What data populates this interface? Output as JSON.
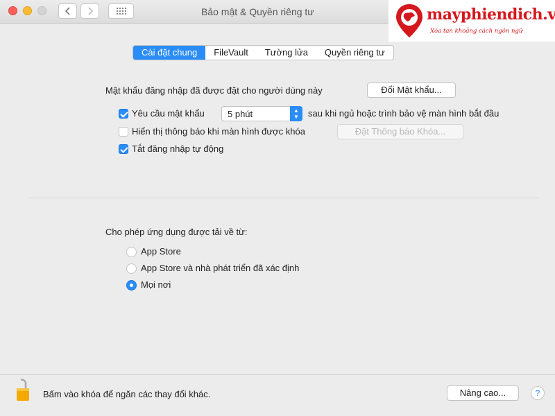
{
  "window": {
    "title": "Bảo mật & Quyền riêng tư"
  },
  "toolbar": {
    "back_icon": "chevron-left-icon",
    "forward_icon": "chevron-right-icon",
    "grid_icon": "grid-icon"
  },
  "logo": {
    "text": "mayphiendich.vn",
    "slogan": "Xóa tan khoảng cách ngôn ngữ",
    "color": "#d4181e"
  },
  "tabs": [
    {
      "label": "Cài đặt chung",
      "active": true
    },
    {
      "label": "FileVault",
      "active": false
    },
    {
      "label": "Tường lửa",
      "active": false
    },
    {
      "label": "Quyền riêng tư",
      "active": false
    }
  ],
  "general": {
    "password_text": "Mật khẩu đăng nhập đã được đặt cho người dùng này",
    "change_password_button": "Đổi Mật khẩu...",
    "require_password": {
      "checked": true,
      "label": "Yêu cầu mật khẩu",
      "delay_value": "5 phút",
      "after_text": "sau khi ngủ hoặc trình bảo vệ màn hình bắt đầu"
    },
    "show_message": {
      "checked": false,
      "label": "Hiển thị thông báo khi màn hình được khóa",
      "button": "Đặt Thông báo Khóa..."
    },
    "disable_autologin": {
      "checked": true,
      "label": "Tắt đăng nhập tự động"
    }
  },
  "downloads": {
    "heading": "Cho phép ứng dụng được tải về từ:",
    "options": [
      {
        "label": "App Store",
        "selected": false
      },
      {
        "label": "App Store và nhà phát triển đã xác định",
        "selected": false
      },
      {
        "label": "Mọi nơi",
        "selected": true
      }
    ]
  },
  "footer": {
    "lock_text": "Bấm vào khóa để ngăn các thay đổi khác.",
    "advanced_button": "Nâng cao...",
    "help_label": "?"
  },
  "colors": {
    "accent": "#2a8cf7",
    "background": "#ececec"
  }
}
